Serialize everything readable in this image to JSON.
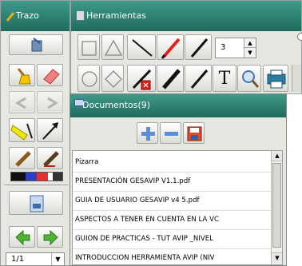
{
  "trazo_panel": {
    "title": "Trazo",
    "page_value": "1/1"
  },
  "herramientas": {
    "title": "Herramientas",
    "thickness_value": "3",
    "text_tool_glyph": "T"
  },
  "documentos": {
    "title": "Documentos(9)",
    "files": [
      "Pizarra",
      "PRESENTACIÓN GESAVIP V1.1.pdf",
      "GUIA DE USUARIO GESAVIP v4 5.pdf",
      "ASPECTOS A TENER EN CUENTA EN LA VC",
      "GUION DE PRACTICAS - TUT AVIP _NIVEL",
      "INTRODUCCION HERRAMIENTA AVIP (NIV"
    ]
  },
  "colors": {
    "teal_header": "#2a7d6f",
    "red_pen": "#e0201e",
    "black_pen": "#111111",
    "blue_swatch": "#2a3ec9",
    "red_swatch": "#e33030"
  }
}
